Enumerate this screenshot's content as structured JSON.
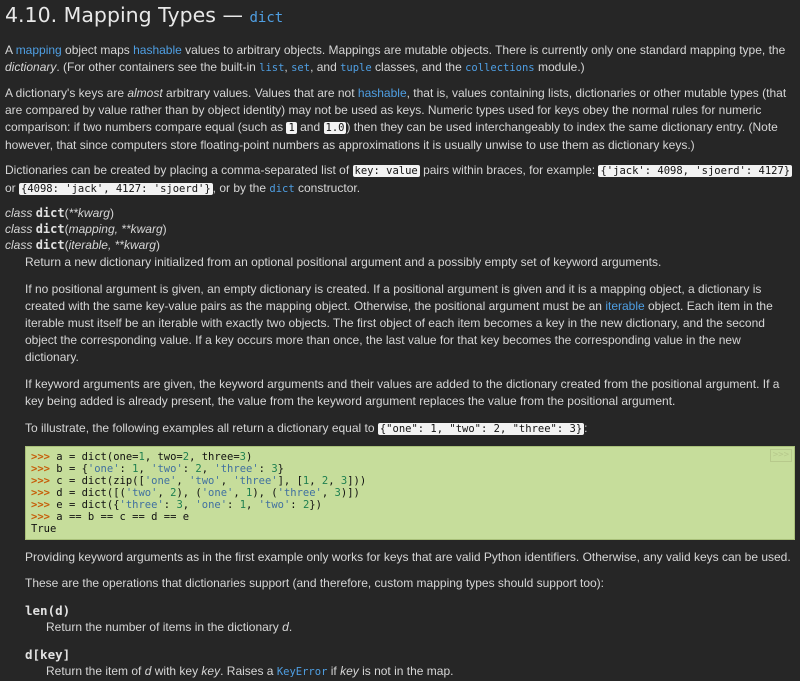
{
  "heading": {
    "title": "4.10. Mapping Types — ",
    "code": "dict"
  },
  "para1": {
    "t1": "A ",
    "l1": "mapping",
    "t2": " object maps ",
    "l2": "hashable",
    "t3": " values to arbitrary objects. Mappings are mutable objects. There is currently only one standard mapping type, the ",
    "em1": "dictionary",
    "t4": ". (For other containers see the built-in ",
    "c1": "list",
    "t5": ", ",
    "c2": "set",
    "t6": ", and ",
    "c3": "tuple",
    "t7": " classes, and the ",
    "c4": "collections",
    "t8": " module.)"
  },
  "para2": {
    "t1": "A dictionary's keys are ",
    "em1": "almost",
    "t2": " arbitrary values. Values that are not ",
    "l1": "hashable",
    "t3": ", that is, values containing lists, dictionaries or other mutable types (that are compared by value rather than by object identity) may not be used as keys. Numeric types used for keys obey the normal rules for numeric comparison: if two numbers compare equal (such as ",
    "c1": "1",
    "t4": " and ",
    "c2": "1.0",
    "t5": ") then they can be used interchangeably to index the same dictionary entry. (Note however, that since computers store floating-point numbers as approximations it is usually unwise to use them as dictionary keys.)"
  },
  "para3": {
    "t1": "Dictionaries can be created by placing a comma-separated list of ",
    "c1": "key: value",
    "t2": " pairs within braces, for example: ",
    "c2": "{'jack': 4098, 'sjoerd': 4127}",
    "t3": " or ",
    "c3": "{4098: 'jack', 4127: 'sjoerd'}",
    "t4": ", or by the ",
    "c4": "dict",
    "t5": " constructor."
  },
  "signatures": [
    {
      "kw": "class ",
      "name": "dict",
      "args": "**kwarg"
    },
    {
      "kw": "class ",
      "name": "dict",
      "args": "mapping, **kwarg"
    },
    {
      "kw": "class ",
      "name": "dict",
      "args": "iterable, **kwarg"
    }
  ],
  "desc1": "Return a new dictionary initialized from an optional positional argument and a possibly empty set of keyword arguments.",
  "desc2": {
    "t1": "If no positional argument is given, an empty dictionary is created. If a positional argument is given and it is a mapping object, a dictionary is created with the same key-value pairs as the mapping object. Otherwise, the positional argument must be an ",
    "l1": "iterable",
    "t2": " object. Each item in the iterable must itself be an iterable with exactly two objects. The first object of each item becomes a key in the new dictionary, and the second object the corresponding value. If a key occurs more than once, the last value for that key becomes the corresponding value in the new dictionary."
  },
  "desc3": "If keyword arguments are given, the keyword arguments and their values are added to the dictionary created from the positional argument. If a key being added is already present, the value from the keyword argument replaces the value from the positional argument.",
  "desc4": {
    "t1": "To illustrate, the following examples all return a dictionary equal to ",
    "c1": "{\"one\": 1, \"two\": 2, \"three\": 3}",
    "t2": ":"
  },
  "code": {
    "copy_label": ">>>",
    "prompt": ">>> ",
    "output": "True"
  },
  "desc5": "Providing keyword arguments as in the first example only works for keys that are valid Python identifiers. Otherwise, any valid keys can be used.",
  "desc6": "These are the operations that dictionaries support (and therefore, custom mapping types should support too):",
  "ops": [
    {
      "name": "len(d)",
      "t1": "Return the number of items in the dictionary ",
      "em1": "d",
      "t2": ".",
      "t3": "",
      "l1": "",
      "t4": "",
      "em2": "",
      "t5": ""
    },
    {
      "name": "d[key]",
      "t1": "Return the item of ",
      "em1": "d",
      "t2": " with key ",
      "em2": "key",
      "t3": ". Raises a ",
      "l1": "KeyError",
      "t4": " if ",
      "em3": "key",
      "t5": " is not in the map."
    }
  ]
}
